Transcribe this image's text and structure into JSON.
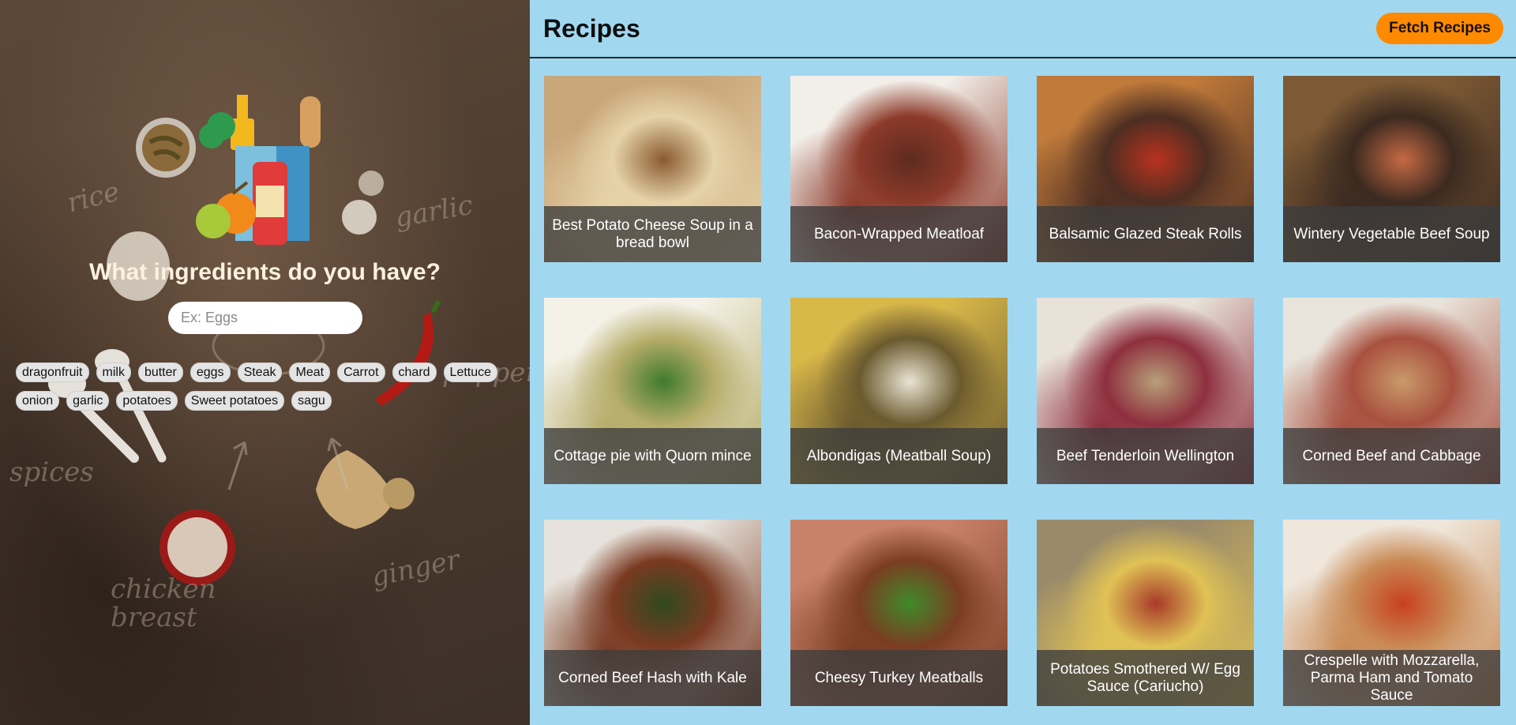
{
  "sidebar": {
    "headline": "What ingredients do you have?",
    "search_placeholder": "Ex: Eggs",
    "ingredients": [
      "dragonfruit",
      "milk",
      "butter",
      "eggs",
      "Steak",
      "Meat",
      "Carrot",
      "chard",
      "Lettuce",
      "onion",
      "garlic",
      "potatoes",
      "Sweet potatoes",
      "sagu"
    ],
    "sketch_labels": [
      "rice",
      "garlic",
      "spices",
      "chicken breast",
      "ginger",
      "pepper"
    ]
  },
  "header": {
    "title": "Recipes",
    "fetch_label": "Fetch Recipes"
  },
  "recipes": [
    {
      "name": "Best Potato Cheese Soup in a bread bowl",
      "colors": [
        "#c9a57a",
        "#e6d3a8",
        "#8a5a32"
      ]
    },
    {
      "name": "Bacon-Wrapped Meatloaf",
      "colors": [
        "#f2efe9",
        "#8c3a2a",
        "#5e2b1f"
      ]
    },
    {
      "name": "Balsamic Glazed Steak Rolls",
      "colors": [
        "#c07a3a",
        "#4d2e22",
        "#b8321e"
      ]
    },
    {
      "name": "Wintery Vegetable Beef Soup",
      "colors": [
        "#7d5a35",
        "#3c2a20",
        "#c66a44"
      ]
    },
    {
      "name": "Cottage pie with Quorn mince",
      "colors": [
        "#f4f1e7",
        "#b6ad6a",
        "#3f7a2d"
      ]
    },
    {
      "name": "Albondigas (Meatball Soup)",
      "colors": [
        "#d9b84a",
        "#6b5a2e",
        "#e9e4d4"
      ]
    },
    {
      "name": "Beef Tenderloin Wellington",
      "colors": [
        "#e8e2d8",
        "#8e2f3e",
        "#b8a07a"
      ]
    },
    {
      "name": "Corned Beef and Cabbage",
      "colors": [
        "#e9e4db",
        "#a8503f",
        "#c99a6a"
      ]
    },
    {
      "name": "Corned Beef Hash with Kale",
      "colors": [
        "#e7e3dc",
        "#7a3a22",
        "#2f4a1e"
      ]
    },
    {
      "name": "Cheesy Turkey Meatballs",
      "colors": [
        "#c9826a",
        "#7a3d22",
        "#3f8a2a"
      ]
    },
    {
      "name": "Potatoes Smothered W/ Egg Sauce (Cariucho)",
      "colors": [
        "#9a8a6a",
        "#e0c255",
        "#a83a2a"
      ]
    },
    {
      "name": "Crespelle with Mozzarella, Parma Ham and Tomato Sauce",
      "colors": [
        "#efe7dc",
        "#c98a55",
        "#c8401e"
      ]
    }
  ]
}
